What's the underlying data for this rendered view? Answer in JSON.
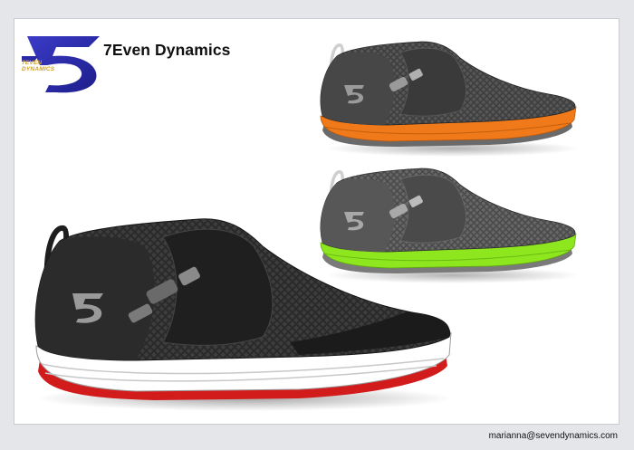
{
  "brand": {
    "name": "7Even Dynamics",
    "logo_text": "7EVEN DYNAMICS",
    "logo_color": "#2a2aa8"
  },
  "footer": {
    "email": "marianna@sevendynamics.com"
  },
  "shoes": [
    {
      "name": "main-black-red",
      "upper": "#2b2b2b",
      "sole_accent": "#d21c1c",
      "midsole": "#ffffff"
    },
    {
      "name": "grey-orange",
      "upper": "#4a4a4a",
      "sole_accent": "#f07a1a",
      "midsole": "#f07a1a"
    },
    {
      "name": "grey-lime",
      "upper": "#5c5c5c",
      "sole_accent": "#8ee61e",
      "midsole": "#8ee61e"
    }
  ]
}
